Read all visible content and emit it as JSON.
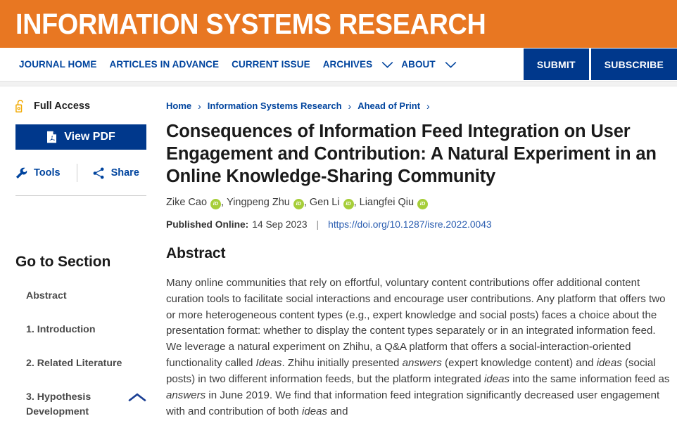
{
  "masthead": {
    "journal_title": "INFORMATION SYSTEMS RESEARCH",
    "background_color": "#e87722"
  },
  "navbar": {
    "accent_color": "#00388c",
    "link_color": "#00449e",
    "items": [
      {
        "label": "JOURNAL HOME",
        "has_caret": false
      },
      {
        "label": "ARTICLES IN ADVANCE",
        "has_caret": false
      },
      {
        "label": "CURRENT ISSUE",
        "has_caret": false
      },
      {
        "label": "ARCHIVES",
        "has_caret": true
      },
      {
        "label": "ABOUT",
        "has_caret": true
      }
    ],
    "cta": [
      {
        "label": "SUBMIT"
      },
      {
        "label": "SUBSCRIBE"
      }
    ]
  },
  "sidebar": {
    "access": {
      "label": "Full Access",
      "icon": "open-lock-icon",
      "icon_color": "#f2a900"
    },
    "pdf_button": {
      "label": "View PDF",
      "icon": "pdf-file-icon"
    },
    "tools": [
      {
        "label": "Tools",
        "icon": "wrench-icon"
      },
      {
        "label": "Share",
        "icon": "share-icon"
      }
    ],
    "go_to_section": {
      "heading": "Go to Section",
      "items": [
        {
          "label": "Abstract",
          "expandable": false
        },
        {
          "label": "1. Introduction",
          "expandable": false
        },
        {
          "label": "2. Related Literature",
          "expandable": false
        },
        {
          "label": "3. Hypothesis Development",
          "expandable": true,
          "icon": "chevron-up-icon"
        }
      ]
    }
  },
  "article": {
    "breadcrumb": [
      {
        "label": "Home"
      },
      {
        "label": "Information Systems Research"
      },
      {
        "label": "Ahead of Print"
      }
    ],
    "breadcrumb_separator": "›",
    "title": "Consequences of Information Feed Integration on User Engagement and Contribution: A Natural Experiment in an Online Knowledge-Sharing Community",
    "authors": [
      {
        "name": "Zike Cao",
        "orcid": "iD"
      },
      {
        "name": "Yingpeng Zhu",
        "orcid": "iD"
      },
      {
        "name": "Gen Li",
        "orcid": "iD"
      },
      {
        "name": "Liangfei Qiu",
        "orcid": "iD"
      }
    ],
    "published": {
      "label": "Published Online:",
      "date": "14 Sep 2023",
      "separator": "|",
      "doi": "https://doi.org/10.1287/isre.2022.0043"
    },
    "abstract": {
      "heading": "Abstract",
      "segments": [
        {
          "text": "Many online communities that rely on effortful, voluntary content contributions offer additional content curation tools to facilitate social interactions and encourage user contributions. Any platform that offers two or more heterogeneous content types (e.g., expert knowledge and social posts) faces a choice about the presentation format: whether to display the content types separately or in an integrated information feed. We leverage a natural experiment on Zhihu, a Q&A platform that offers a social-interaction-oriented functionality called ",
          "italic": false
        },
        {
          "text": "Ideas",
          "italic": true
        },
        {
          "text": ". Zhihu initially presented ",
          "italic": false
        },
        {
          "text": "answers",
          "italic": true
        },
        {
          "text": " (expert knowledge content) and ",
          "italic": false
        },
        {
          "text": "ideas",
          "italic": true
        },
        {
          "text": " (social posts) in two different information feeds, but the platform integrated ",
          "italic": false
        },
        {
          "text": "ideas",
          "italic": true
        },
        {
          "text": " into the same information feed as ",
          "italic": false
        },
        {
          "text": "answers",
          "italic": true
        },
        {
          "text": " in June 2019. We find that information feed integration significantly decreased user engagement with and contribution of both ",
          "italic": false
        },
        {
          "text": "ideas",
          "italic": true
        },
        {
          "text": " and",
          "italic": false
        }
      ]
    }
  }
}
